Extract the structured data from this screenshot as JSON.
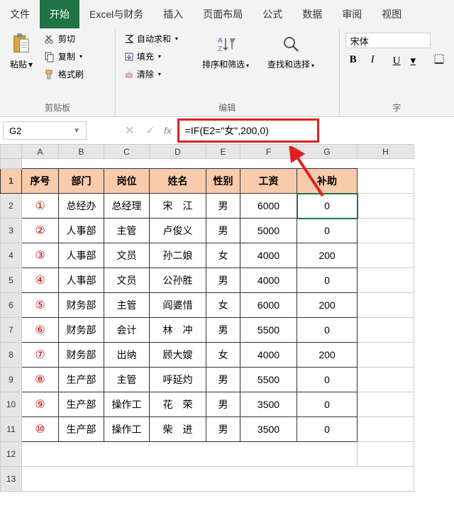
{
  "tabs": [
    "文件",
    "开始",
    "Excel与财务",
    "插入",
    "页面布局",
    "公式",
    "数据",
    "审阅",
    "视图"
  ],
  "active_tab": 1,
  "ribbon": {
    "clipboard": {
      "paste": "粘贴",
      "cut": "剪切",
      "copy": "复制",
      "format_painter": "格式刷",
      "label": "剪贴板"
    },
    "edit": {
      "autosum": "自动求和",
      "fill": "填充",
      "clear": "清除",
      "sort_filter": "排序和筛选",
      "find_select": "查找和选择",
      "label": "编辑"
    },
    "font": {
      "name": "宋体",
      "bold": "B",
      "italic": "I",
      "underline": "U",
      "label": "字"
    }
  },
  "namebox": "G2",
  "formula": "=IF(E2=\"女\",200,0)",
  "columns": [
    "A",
    "B",
    "C",
    "D",
    "E",
    "F",
    "G",
    "H"
  ],
  "header_row": [
    "序号",
    "部门",
    "岗位",
    "姓名",
    "性别",
    "工资",
    "补助"
  ],
  "circled": [
    "①",
    "②",
    "③",
    "④",
    "⑤",
    "⑥",
    "⑦",
    "⑧",
    "⑨",
    "⑩"
  ],
  "rows": [
    [
      "总经办",
      "总经理",
      "宋　江",
      "男",
      "6000",
      "0"
    ],
    [
      "人事部",
      "主管",
      "卢俊义",
      "男",
      "5000",
      "0"
    ],
    [
      "人事部",
      "文员",
      "孙二娘",
      "女",
      "4000",
      "200"
    ],
    [
      "人事部",
      "文员",
      "公孙胜",
      "男",
      "4000",
      "0"
    ],
    [
      "财务部",
      "主管",
      "阎婆惜",
      "女",
      "6000",
      "200"
    ],
    [
      "财务部",
      "会计",
      "林　冲",
      "男",
      "5500",
      "0"
    ],
    [
      "财务部",
      "出纳",
      "顾大嫂",
      "女",
      "4000",
      "200"
    ],
    [
      "生产部",
      "主管",
      "呼延灼",
      "男",
      "5500",
      "0"
    ],
    [
      "生产部",
      "操作工",
      "花　荣",
      "男",
      "3500",
      "0"
    ],
    [
      "生产部",
      "操作工",
      "柴　进",
      "男",
      "3500",
      "0"
    ]
  ],
  "chart_data": {
    "type": "table",
    "title": "补助 calculated via =IF(E2=\"女\",200,0)",
    "columns": [
      "序号",
      "部门",
      "岗位",
      "姓名",
      "性别",
      "工资",
      "补助"
    ],
    "data": [
      [
        "①",
        "总经办",
        "总经理",
        "宋江",
        "男",
        6000,
        0
      ],
      [
        "②",
        "人事部",
        "主管",
        "卢俊义",
        "男",
        5000,
        0
      ],
      [
        "③",
        "人事部",
        "文员",
        "孙二娘",
        "女",
        4000,
        200
      ],
      [
        "④",
        "人事部",
        "文员",
        "公孙胜",
        "男",
        4000,
        0
      ],
      [
        "⑤",
        "财务部",
        "主管",
        "阎婆惜",
        "女",
        6000,
        200
      ],
      [
        "⑥",
        "财务部",
        "会计",
        "林冲",
        "男",
        5500,
        0
      ],
      [
        "⑦",
        "财务部",
        "出纳",
        "顾大嫂",
        "女",
        4000,
        200
      ],
      [
        "⑧",
        "生产部",
        "主管",
        "呼延灼",
        "男",
        5500,
        0
      ],
      [
        "⑨",
        "生产部",
        "操作工",
        "花荣",
        "男",
        3500,
        0
      ],
      [
        "⑩",
        "生产部",
        "操作工",
        "柴进",
        "男",
        3500,
        0
      ]
    ]
  }
}
